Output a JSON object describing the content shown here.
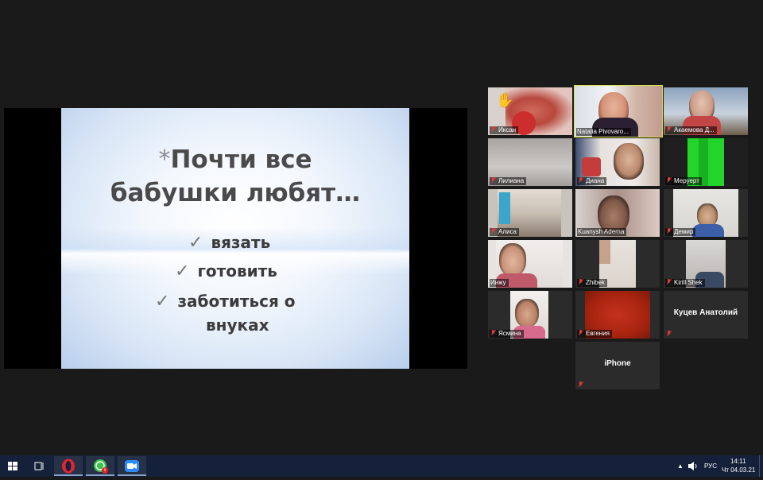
{
  "slide": {
    "title_line1": "Почти все",
    "title_line2": "бабушки любят…",
    "star": "*",
    "bullets": [
      "вязать",
      "готовить",
      "заботиться о",
      "внуках"
    ],
    "check": "✓"
  },
  "participants": [
    {
      "name": "Иксан",
      "hand_raised": true
    },
    {
      "name": "Natalia Pivovaro...",
      "active_speaker": true
    },
    {
      "name": "Акаемова Д..."
    },
    {
      "name": "Лилиана"
    },
    {
      "name": "Диана"
    },
    {
      "name": "Меруерт"
    },
    {
      "name": "Алиса"
    },
    {
      "name": "Kuanysh Adema"
    },
    {
      "name": "Демир"
    },
    {
      "name": "Инжу"
    },
    {
      "name": "Zhibek"
    },
    {
      "name": "Kirill Shek"
    },
    {
      "name": "Ясмина"
    },
    {
      "name": "Евгения"
    },
    {
      "name": "Куцев Анатолий",
      "video_off": true
    },
    {
      "name": "iPhone",
      "video_off": true
    }
  ],
  "taskbar": {
    "apps": [
      "opera-browser",
      "whatsapp",
      "zoom"
    ],
    "lang": "РУС",
    "time": "14:11",
    "date": "Чт 04.03.21"
  },
  "colors": {
    "active_border": "#d7e04b",
    "muted_mic": "#e23a3a",
    "taskbar": "#15213a"
  }
}
